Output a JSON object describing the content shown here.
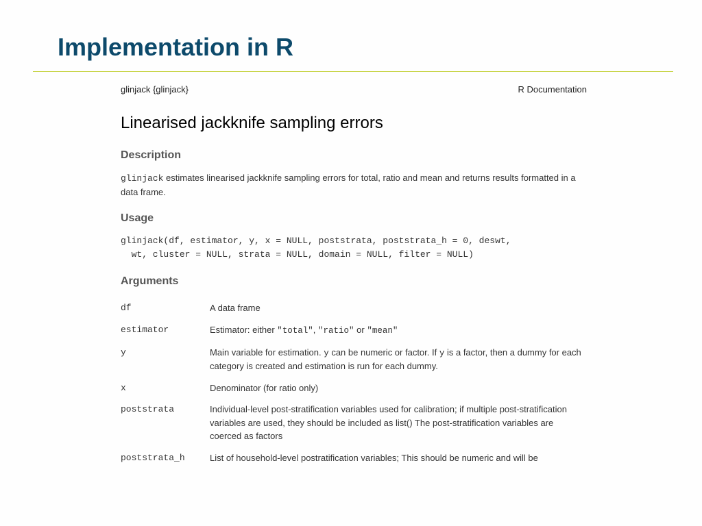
{
  "slide": {
    "title": "Implementation in R"
  },
  "hdr": {
    "left": "glinjack {glinjack}",
    "right": "R Documentation"
  },
  "doc_title": "Linearised jackknife sampling errors",
  "sections": {
    "description": "Description",
    "usage": "Usage",
    "arguments": "Arguments"
  },
  "desc": {
    "pre": "glinjack",
    "post": " estimates linearised jackknife sampling errors for total, ratio and mean and returns results formatted in a data frame."
  },
  "usage_code": "glinjack(df, estimator, y, x = NULL, poststrata, poststrata_h = 0, deswt,\n  wt, cluster = NULL, strata = NULL, domain = NULL, filter = NULL)",
  "args": [
    {
      "name": "df",
      "desc_plain": "A data frame"
    },
    {
      "name": "estimator",
      "parts": {
        "a": "Estimator: either ",
        "b": "\"total\"",
        "c": ", ",
        "d": "\"ratio\"",
        "e": " or ",
        "f": "\"mean\""
      }
    },
    {
      "name": "y",
      "parts": {
        "a": "Main variable for estimation. ",
        "b": "y",
        "c": " can be numeric or factor. If ",
        "d": "y",
        "e": " is a factor, then a dummy for each category is created and estimation is run for each dummy."
      }
    },
    {
      "name": "x",
      "desc_plain": "Denominator (for ratio only)"
    },
    {
      "name": "poststrata",
      "desc_plain": "Individual-level post-stratification variables used for calibration; if multiple post-stratification variables are used, they should be included as list() The post-stratification variables are coerced as factors"
    },
    {
      "name": "poststrata_h",
      "desc_plain": "List of household-level postratification variables; This should be numeric and will be"
    }
  ]
}
